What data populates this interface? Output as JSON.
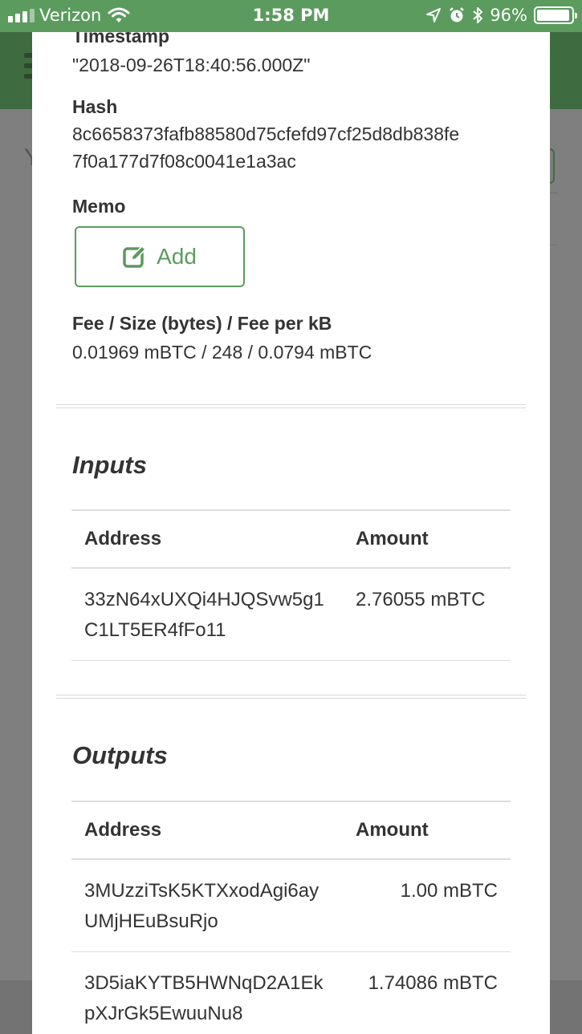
{
  "status_bar": {
    "carrier": "Verizon",
    "time": "1:58 PM",
    "battery": "96%",
    "battery_level": 0.96
  },
  "background": {
    "letter": "Y"
  },
  "details": {
    "timestamp_label": "Timestamp",
    "timestamp_value": "\"2018-09-26T18:40:56.000Z\"",
    "hash_label": "Hash",
    "hash_value_line1": "8c6658373fafb88580d75cfefd97cf25d8db838fe",
    "hash_value_line2": "7f0a177d7f08c0041e1a3ac",
    "memo_label": "Memo",
    "memo_add_label": "Add",
    "fee_label": "Fee / Size (bytes) / Fee per kB",
    "fee_value": "0.01969 mBTC / 248 / 0.0794 mBTC"
  },
  "inputs": {
    "title": "Inputs",
    "headers": {
      "address": "Address",
      "amount": "Amount"
    },
    "rows": [
      {
        "address": "33zN64xUXQi4HJQSvw5g1C1LT5ER4fFo11",
        "amount": "2.76055 mBTC"
      }
    ]
  },
  "outputs": {
    "title": "Outputs",
    "headers": {
      "address": "Address",
      "amount": "Amount"
    },
    "rows": [
      {
        "address": "3MUzziTsK5KTXxodAgi6ayUMjHEuBsuRjo",
        "amount": "1.00 mBTC"
      },
      {
        "address": "3D5iaKYTB5HWNqD2A1EkpXJrGk5EwuuNu8",
        "amount": "1.74086 mBTC"
      }
    ]
  }
}
